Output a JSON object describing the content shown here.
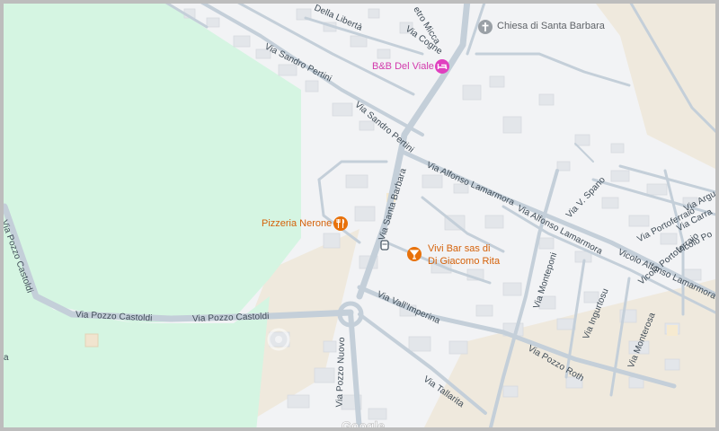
{
  "map": {
    "colors": {
      "land": "#f2f3f5",
      "park": "#d5f5e2",
      "sand": "#efe9dd",
      "road": "#c4cfd9",
      "road_casing": "#b3bfca",
      "building": "#e3e6ea",
      "frame": "#bdbdbd",
      "road_label": "#3d4a55",
      "food_accent": "#e8710a",
      "lodging_accent": "#e03fbf",
      "church_accent": "#70757a"
    },
    "roads": {
      "via_della_liberta": "Della Libertà",
      "via_micca": "etro Micca",
      "via_cogne": "Via Cogne",
      "via_sandro_pertini_1": "Via Sandro Pertini",
      "via_sandro_pertini_2": "Via Sandro Pertini",
      "via_santa_barbara": "Via Santa Barbara",
      "via_alfonso_lamarmora_1": "Via Alfonso Lamarmora",
      "via_alfonso_lamarmora_2": "Via Alfonso Lamarmora",
      "vicolo_alfonso_lamarmora": "Vicolo Alfonso Lamarmora",
      "via_v_spano": "Via V. Spano",
      "via_argu": "Via Argu",
      "via_carra": "Via Carra",
      "vicolo_po": "Vicolo Po",
      "via_portoferraio": "Via Portoferraio",
      "vicolo_portoferraio": "Vicolo Portoferraio",
      "via_monteponi": "Via Monteponi",
      "via_ingurtosu": "Via Ingurtosu",
      "via_monterosa": "Via Monterosa",
      "via_pozzo_roth": "Via Pozzo Roth",
      "via_vallimperina": "Via Vall'Imperina",
      "via_tallarita": "Via Tallarita",
      "via_pozzo_castoldi_vertical": "Via Pozzo Castoldi",
      "via_pozzo_castoldi_1": "Via Pozzo Castoldi",
      "via_pozzo_castoldi_2": "Via Pozzo Castoldi",
      "via_pozzo_nuovo": "Via Pozzo Nuovo",
      "edge_fragment": "a"
    },
    "pois": {
      "church": {
        "name": "Chiesa di Santa Barbara",
        "icon": "cross-icon"
      },
      "bnb": {
        "name": "B&B Del Viale",
        "icon": "bed-icon"
      },
      "pizzeria": {
        "name": "Pizzeria Nerone",
        "icon": "fork-knife-icon"
      },
      "bar_line1": "Vivi Bar sas di",
      "bar_line2": "Di Giacomo Rita",
      "bar_icon": "cocktail-icon"
    },
    "attribution": "Google"
  }
}
